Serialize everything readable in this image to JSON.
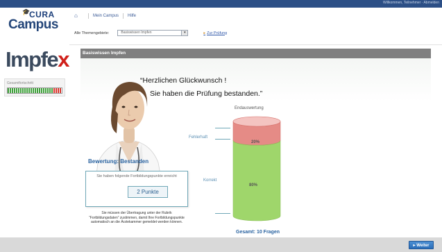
{
  "header": {
    "user_text": "Willkommen, Teilnehmer · Abmelden",
    "logo_top": "CURA",
    "logo_bottom": "Campus",
    "nav": {
      "mein_campus": "Mein Campus",
      "hilfe": "Hilfe"
    }
  },
  "toolbar": {
    "themen_label": "Alle Themengebiete:",
    "select_value": "Basiswissen Impfen",
    "pruefung_link": "Zur Prüfung"
  },
  "sidebar": {
    "brand": "Impfe",
    "brand_x": "x",
    "progress_label": "Gesamtfortschritt",
    "progress_fraction": 0.85
  },
  "panel": {
    "title": "Basiswissen Impfen",
    "congrats_line1": "“Herzlichen Glückwunsch !",
    "congrats_line2": "Sie haben die Prüfung bestanden.”",
    "chart_title": "Endauswertung",
    "bewertung": "Bewertung: Bestanden",
    "info_text": "Sie haben folgende Fortbildungspunkte erreicht",
    "punkte": "2 Punkte",
    "hint": "Sie müssen der Übertragung unter der Rubrik “Fortbildungsdaten” zustimmen, damit Ihre Fortbildungspunkte automatisch an die Ärztekammer gemeldet werden können.",
    "total": "Gesamt: 10 Fragen"
  },
  "chart_data": {
    "type": "bar",
    "title": "Endauswertung",
    "categories": [
      "Fehlerhaft",
      "Korrekt"
    ],
    "values": [
      20,
      80
    ],
    "value_labels": [
      "20%",
      "80%"
    ],
    "total_label": "Gesamt: 10 Fragen",
    "colors": {
      "Fehlerhaft": "#e58b86",
      "Korrekt": "#9fd66b"
    }
  },
  "footer": {
    "weiter": "Weiter"
  },
  "colors": {
    "accent": "#2c4f86",
    "link": "#2a63a0",
    "panel_header": "#7f7f7f"
  }
}
